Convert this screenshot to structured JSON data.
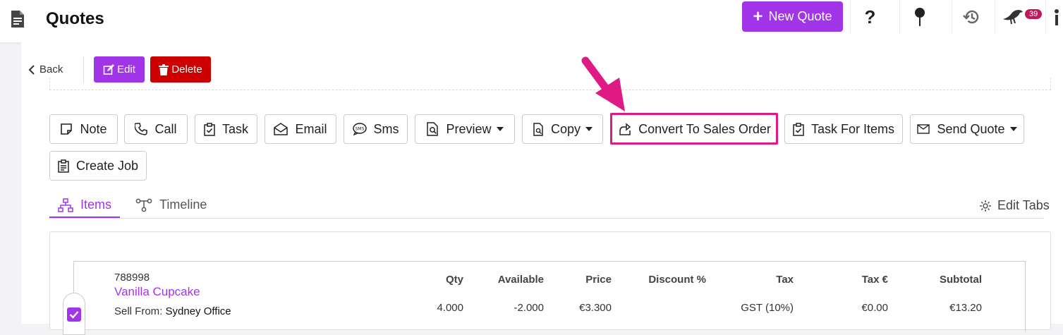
{
  "header": {
    "title": "Quotes",
    "new_quote_label": "New Quote",
    "notification_count": "39",
    "icons": [
      "document-icon",
      "help-icon",
      "pin-icon",
      "history-icon",
      "crow-icon",
      "info-icon"
    ]
  },
  "toolbar": {
    "back_label": "Back",
    "edit_label": "Edit",
    "delete_label": "Delete"
  },
  "actions": {
    "note": "Note",
    "call": "Call",
    "task": "Task",
    "email": "Email",
    "sms": "Sms",
    "preview": "Preview",
    "copy": "Copy",
    "convert": "Convert To Sales Order",
    "task_for_items": "Task For Items",
    "send_quote": "Send Quote",
    "create_job": "Create Job"
  },
  "tabs": {
    "items": "Items",
    "timeline": "Timeline",
    "edit_tabs": "Edit Tabs"
  },
  "table": {
    "headers": {
      "qty": "Qty",
      "available": "Available",
      "price": "Price",
      "discount": "Discount %",
      "tax": "Tax",
      "tax_amount": "Tax €",
      "subtotal": "Subtotal"
    },
    "row": {
      "sku": "788998",
      "name": "Vanilla Cupcake",
      "sell_from_label": "Sell From:",
      "sell_from_value": "Sydney Office",
      "qty": "4.000",
      "available": "-2.000",
      "price": "€3.300",
      "discount": "",
      "tax": "GST (10%)",
      "tax_amount": "€0.00",
      "subtotal": "€13.20",
      "checked": true
    }
  },
  "colors": {
    "accent": "#a035e8",
    "danger": "#cc0000",
    "highlight": "#e01a84"
  }
}
